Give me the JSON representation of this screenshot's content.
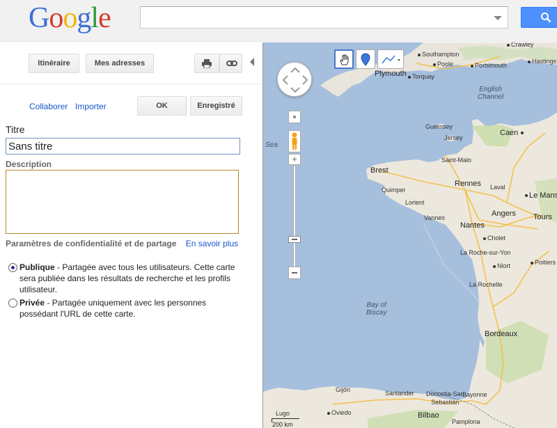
{
  "header": {
    "logo_letters": [
      "G",
      "o",
      "o",
      "g",
      "l",
      "e"
    ],
    "logo_colors": [
      "#3b6fd8",
      "#d63a2f",
      "#f2b600",
      "#3b6fd8",
      "#2c9b3a",
      "#d63a2f"
    ],
    "search_value": "",
    "search_placeholder": ""
  },
  "toolbar": {
    "itineraire_label": "Itinéraire",
    "adresses_label": "Mes adresses"
  },
  "actions": {
    "collaborer_label": "Collaborer",
    "importer_label": "Importer",
    "ok_label": "OK",
    "enregistre_label": "Enregistré"
  },
  "form": {
    "titre_label": "Titre",
    "titre_value": "Sans titre",
    "description_label": "Description",
    "description_value": ""
  },
  "privacy": {
    "heading": "Paramètres de confidentialité et de partage",
    "learn_more": "En savoir plus",
    "public_label": "Publique",
    "public_desc": " - Partagée avec tous les utilisateurs. Cette carte sera publiée dans les résultats de recherche et les profils utilisateur.",
    "private_label": "Privée",
    "private_desc": " - Partagée uniquement avec les personnes possédant l'URL de cette carte.",
    "selected": "public"
  },
  "map": {
    "places": {
      "crawley": "Crawley",
      "southampton": "Southampton",
      "poole": "Poole",
      "portsmouth": "Portsmouth",
      "hastings": "Hastings",
      "plymouth": "Plymouth",
      "torquay": "Torquay",
      "english_channel": "English\nChannel",
      "guernsey": "Guernsey",
      "jersey": "Jersey",
      "caen": "Caen",
      "saint_malo": "Saint-Malo",
      "brest": "Brest",
      "rennes": "Rennes",
      "laval": "Laval",
      "le_mans": "Le Mans",
      "quimper": "Quimper",
      "lorient": "Lorient",
      "vannes": "Vannes",
      "angers": "Angers",
      "tours": "Tours",
      "nantes": "Nantes",
      "cholet": "Cholet",
      "la_roche": "La Roche-sur-Yon",
      "poitiers": "Poitiers",
      "niort": "Niort",
      "la_rochelle": "La Rochelle",
      "bay_of_biscay": "Bay of\nBiscay",
      "bordeaux": "Bordeaux",
      "gijon": "Gijón",
      "oviedo": "Oviedo",
      "santander": "Santander",
      "donostia": "Donostia-San\nSebastián",
      "bayonne": "Bayonne",
      "bilbao": "Bilbao",
      "pamplona": "Pamplona",
      "lugo": "Lugo",
      "sea": "Sea"
    },
    "scale_text": "200 km"
  }
}
